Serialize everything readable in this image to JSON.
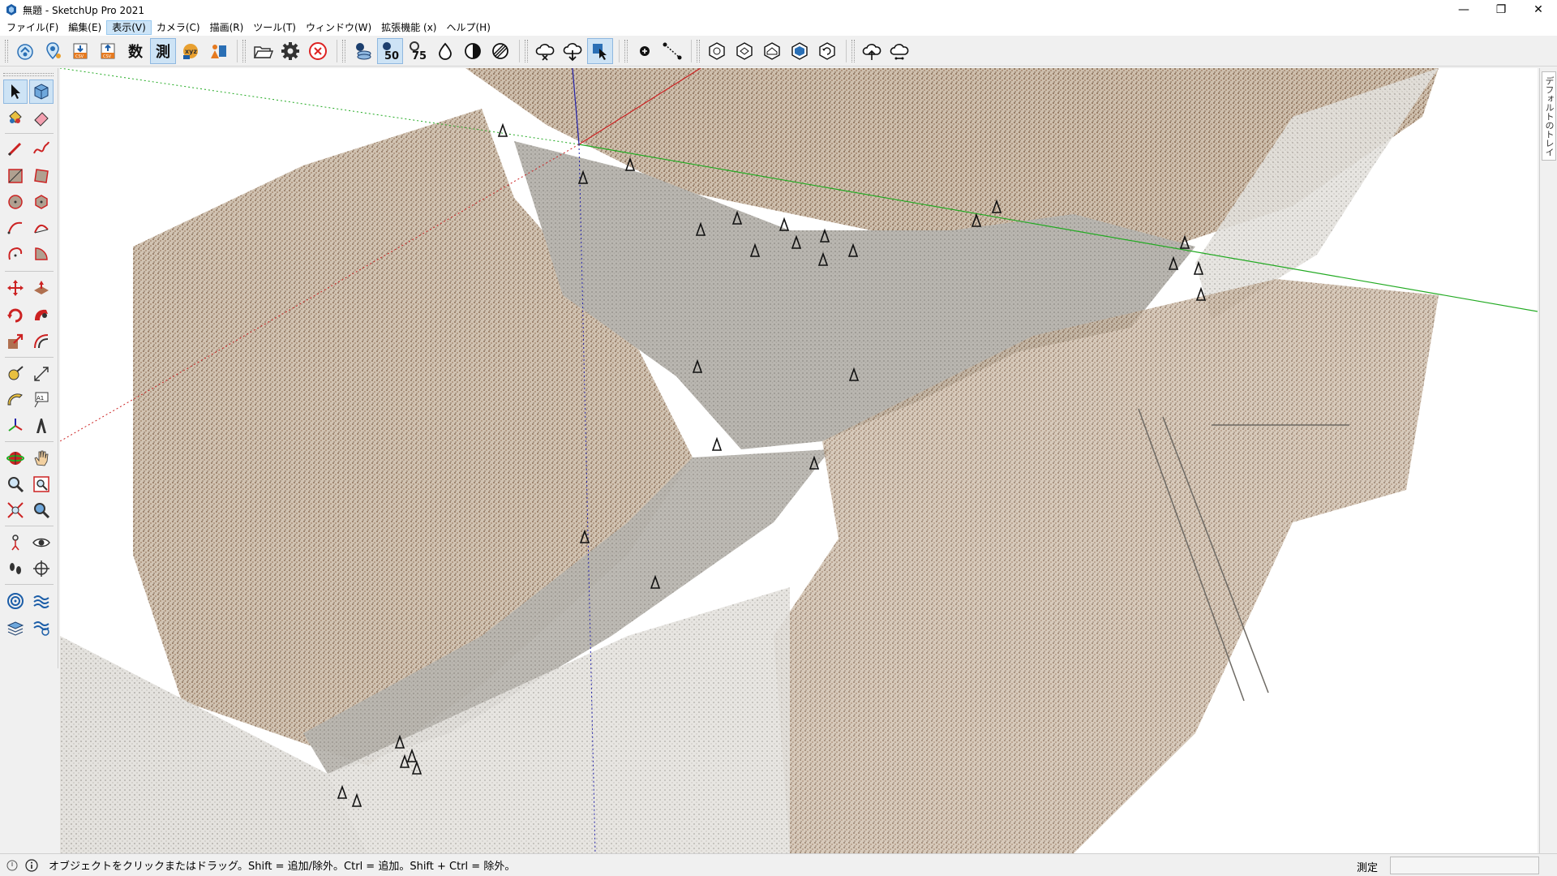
{
  "window": {
    "title": "無題 - SketchUp Pro 2021",
    "app_icon": "sketchup-icon",
    "controls": {
      "minimize": "—",
      "restore": "❐",
      "close": "✕"
    }
  },
  "menu": {
    "items": [
      {
        "label": "ファイル(F)"
      },
      {
        "label": "編集(E)"
      },
      {
        "label": "表示(V)",
        "active": true
      },
      {
        "label": "カメラ(C)"
      },
      {
        "label": "描画(R)"
      },
      {
        "label": "ツール(T)"
      },
      {
        "label": "ウィンドウ(W)"
      },
      {
        "label": "拡張機能 (x)"
      },
      {
        "label": "ヘルプ(H)"
      }
    ]
  },
  "toolbar": {
    "kanji_count": "数",
    "kanji_measure": "測",
    "icon_names": [
      "scan-import-icon",
      "point-pin-icon",
      "csv-import-icon",
      "csv-export-icon",
      "count-icon",
      "measure-icon",
      "xyz-icon",
      "person-chart-icon",
      "open-folder-icon",
      "settings-gear-icon",
      "cancel-circle-icon",
      "layers-scan-icon",
      "density-50-icon",
      "density-75-icon",
      "drop-icon",
      "half-circle-icon",
      "hatched-circle-icon",
      "cloud-cut-icon",
      "cloud-download-icon",
      "cloud-select-icon",
      "point-add-icon",
      "line-points-icon",
      "view-iso-1-icon",
      "view-iso-2-icon",
      "view-top-icon",
      "view-front-icon",
      "view-rotate-icon",
      "cloud-upload-icon",
      "cloud-sync-icon"
    ],
    "density_labels": [
      "50",
      "75"
    ]
  },
  "palette": {
    "icon_names": [
      "select-arrow-icon",
      "make-component-icon",
      "paint-bucket-icon",
      "eraser-icon",
      "pencil-line-icon",
      "freehand-icon",
      "rectangle-icon",
      "rotated-rectangle-icon",
      "circle-icon",
      "polygon-icon",
      "arc-icon",
      "two-point-arc-icon",
      "three-point-arc-icon",
      "pie-icon",
      "move-icon",
      "push-pull-icon",
      "rotate-icon",
      "follow-me-icon",
      "scale-icon",
      "offset-icon",
      "tape-measure-icon",
      "dimension-icon",
      "protractor-icon",
      "text-label-icon",
      "axes-icon",
      "3d-text-icon",
      "orbit-icon",
      "pan-hand-icon",
      "zoom-icon",
      "zoom-window-icon",
      "zoom-extents-icon",
      "previous-view-icon",
      "position-camera-icon",
      "look-around-icon",
      "walk-icon",
      "section-plane-icon",
      "sandbox-from-contours-icon",
      "sandbox-from-scratch-icon",
      "smoove-icon",
      "stamp-icon"
    ],
    "text_tool_label": "A1"
  },
  "tray": {
    "label": "デフォルトのトレイ"
  },
  "status": {
    "message": "オブジェクトをクリックまたはドラッグ。Shift = 追加/除外。Ctrl = 追加。Shift + Ctrl = 除外。",
    "measure_label": "測定",
    "measure_value": ""
  },
  "colors": {
    "axis_red": "#cc2222",
    "axis_green": "#22aa22",
    "axis_blue": "#2222aa",
    "point_cloud_brown": "#8a6b50",
    "point_cloud_gray": "#a8a49e",
    "selected_bg": "#cde3f5"
  }
}
